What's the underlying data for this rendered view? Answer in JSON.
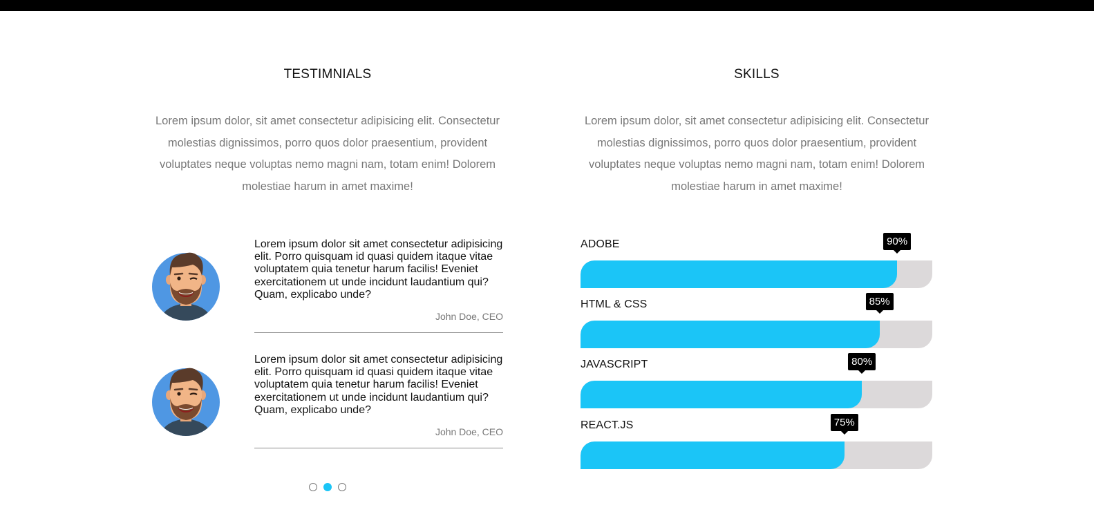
{
  "testimonials": {
    "title": "TESTIMNIALS",
    "description": "Lorem ipsum dolor, sit amet consectetur adipisicing elit. Consectetur molestias dignissimos, porro quos dolor praesentium, provident voluptates neque voluptas nemo magni nam, totam enim! Dolorem molestiae harum in amet maxime!",
    "items": [
      {
        "quote": "Lorem ipsum dolor sit amet consectetur adipisicing elit. Porro quisquam id quasi quidem itaque vitae voluptatem quia tenetur harum facilis! Eveniet exercitationem ut unde incidunt laudantium qui? Quam, explicabo unde?",
        "author": "John Doe, CEO"
      },
      {
        "quote": "Lorem ipsum dolor sit amet consectetur adipisicing elit. Porro quisquam id quasi quidem itaque vitae voluptatem quia tenetur harum facilis! Eveniet exercitationem ut unde incidunt laudantium qui? Quam, explicabo unde?",
        "author": "John Doe, CEO"
      }
    ],
    "pager": {
      "count": 3,
      "active_index": 1
    }
  },
  "skills": {
    "title": "SKILLS",
    "description": "Lorem ipsum dolor, sit amet consectetur adipisicing elit. Consectetur molestias dignissimos, porro quos dolor praesentium, provident voluptates neque voluptas nemo magni nam, totam enim! Dolorem molestiae harum in amet maxime!",
    "items": [
      {
        "name": "ADOBE",
        "percent": 90,
        "label": "90%"
      },
      {
        "name": "HTML & CSS",
        "percent": 85,
        "label": "85%"
      },
      {
        "name": "JAVASCRIPT",
        "percent": 80,
        "label": "80%"
      },
      {
        "name": "REACT.JS",
        "percent": 75,
        "label": "75%"
      }
    ]
  },
  "colors": {
    "accent": "#1bc5f7",
    "track": "#dcd9da",
    "topbar": "#000000",
    "avatar_bg": "#4f97e3"
  },
  "icons": {
    "avatar": "bearded-man-avatar-icon"
  }
}
